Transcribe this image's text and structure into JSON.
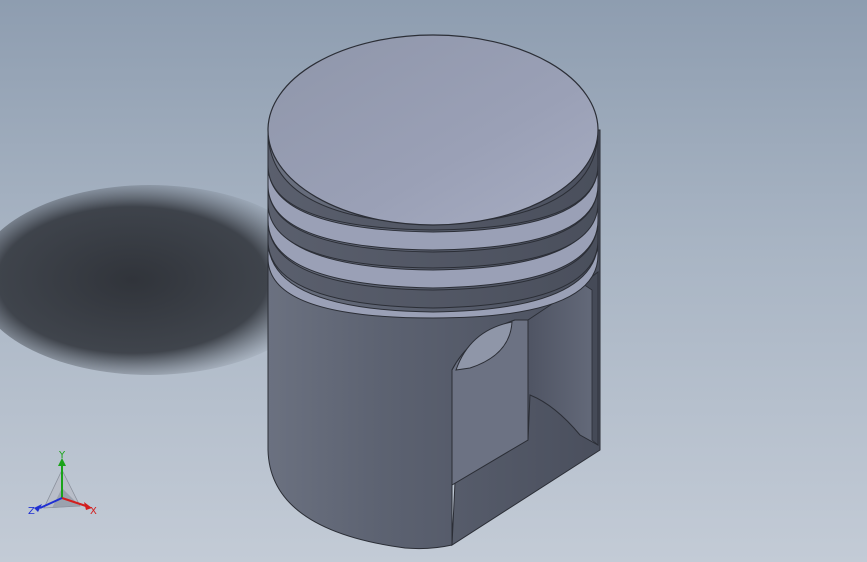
{
  "viewport": {
    "background_top": "#8e9db0",
    "background_bottom": "#c3cbd6",
    "model": "piston"
  },
  "triad": {
    "x_label": "X",
    "y_label": "Y",
    "z_label": "Z",
    "x_color": "#d21e1e",
    "y_color": "#1aa31a",
    "z_color": "#1e2fd2"
  }
}
